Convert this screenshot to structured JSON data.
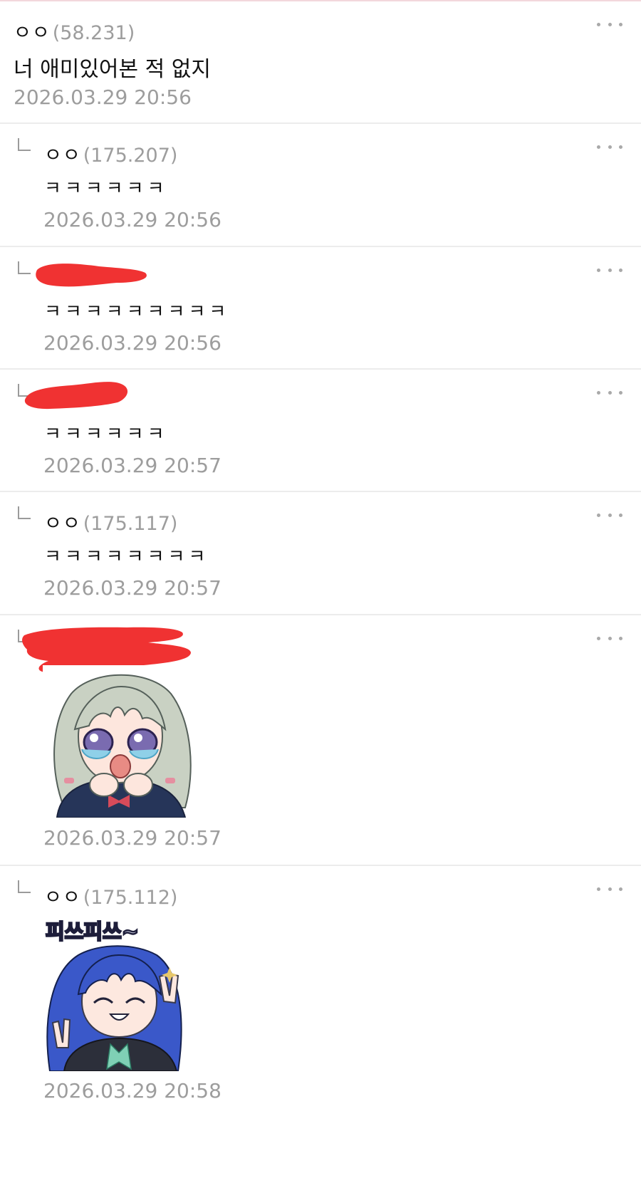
{
  "colors": {
    "divider": "#ececec",
    "secondary_text": "#9d9d9d",
    "redaction": "#f03232",
    "more_dots": "#a9a9a9"
  },
  "comments": [
    {
      "nick": "ㅇㅇ",
      "ip": "(58.231)",
      "text": "너 애미있어본 적 없지",
      "time": "2026.03.29 20:56",
      "reply": false
    },
    {
      "nick": "ㅇㅇ",
      "ip": "(175.207)",
      "text": "ㅋㅋㅋㅋㅋㅋ",
      "time": "2026.03.29 20:56",
      "reply": true
    },
    {
      "nick": "",
      "ip": "",
      "text": "ㅋㅋㅋㅋㅋㅋㅋㅋㅋ",
      "time": "2026.03.29 20:56",
      "reply": true,
      "redacted": true
    },
    {
      "nick": "",
      "ip": "",
      "text": "ㅋㅋㅋㅋㅋㅋ",
      "time": "2026.03.29 20:57",
      "reply": true,
      "redacted": true
    },
    {
      "nick": "ㅇㅇ",
      "ip": "(175.117)",
      "text": "ㅋㅋㅋㅋㅋㅋㅋㅋ",
      "time": "2026.03.29 20:57",
      "reply": true
    },
    {
      "nick": "",
      "ip": "",
      "time": "2026.03.29 20:57",
      "reply": true,
      "redacted": true,
      "sticker": "crying-girl-sticker"
    },
    {
      "nick": "ㅇㅇ",
      "ip": "(175.112)",
      "time": "2026.03.29 20:58",
      "reply": true,
      "sticker": "peace-sign-girl-sticker",
      "sticker_caption": "피쓰피쓰~"
    }
  ]
}
